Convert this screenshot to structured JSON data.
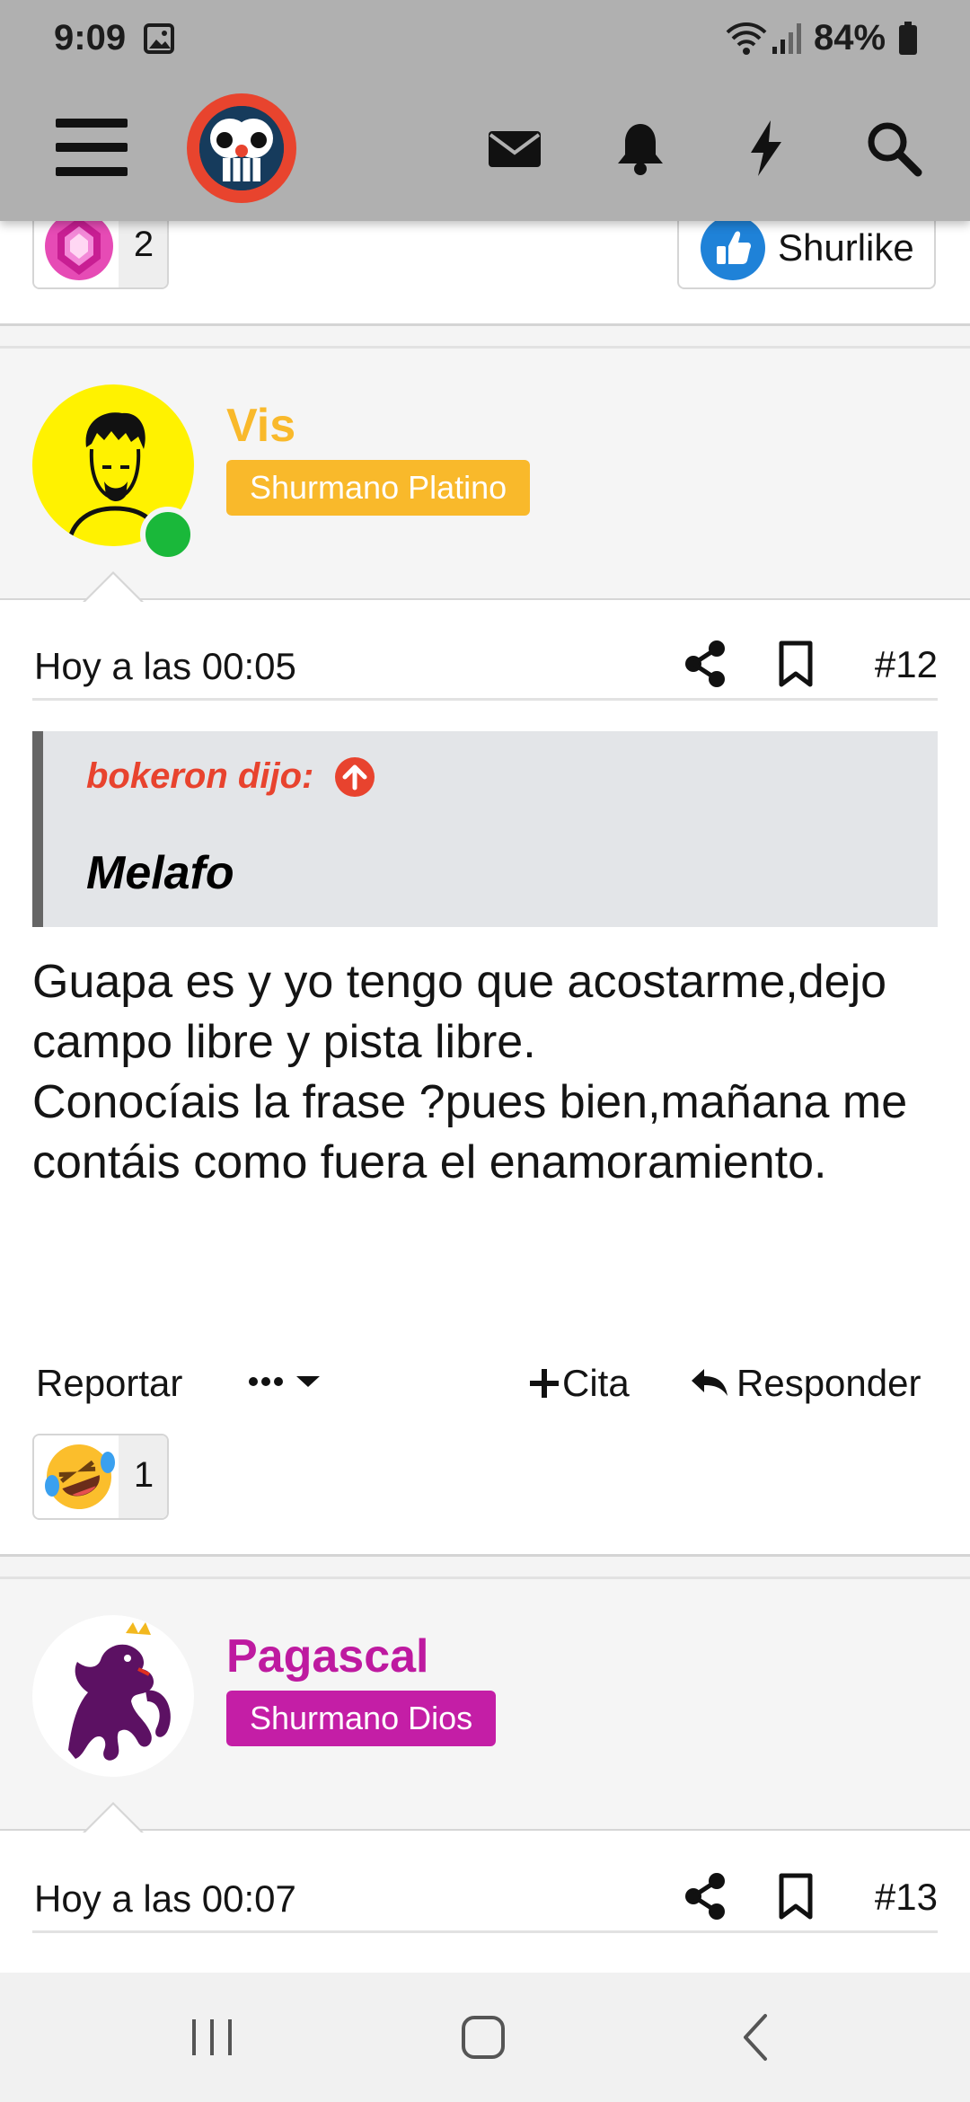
{
  "status_bar": {
    "time": "9:09",
    "battery": "84%"
  },
  "header": {
    "icons": [
      "menu-icon",
      "logo",
      "mail-icon",
      "bell-icon",
      "lightning-icon",
      "search-icon"
    ]
  },
  "previous_post": {
    "reaction_count": "2",
    "shurlike_label": "Shurlike"
  },
  "posts": [
    {
      "username": "Vis",
      "username_color": "#f9b92b",
      "rank": "Shurmano Platino",
      "rank_color": "#f9b92b",
      "online": true,
      "date": "Hoy a las 00:05",
      "number": "#12",
      "quote": {
        "author": "bokeron dijo:",
        "text": "Melafo"
      },
      "body": [
        "Guapa es y yo tengo que acostarme,dejo campo libre y pista libre.",
        "Conocíais la frase ?pues bien,mañana me contáis como fuera el enamoramiento."
      ],
      "actions": {
        "report": "Reportar",
        "quote": "Cita",
        "reply": "Responder"
      },
      "reaction_count": "1"
    },
    {
      "username": "Pagascal",
      "username_color": "#be1aa0",
      "rank": "Shurmano Dios",
      "rank_color": "#c41ea6",
      "date": "Hoy a las 00:07",
      "number": "#13"
    }
  ],
  "colors": {
    "accent_red": "#e8432e",
    "online_green": "#1ab83a",
    "header_bg": "#b0b0b0"
  }
}
